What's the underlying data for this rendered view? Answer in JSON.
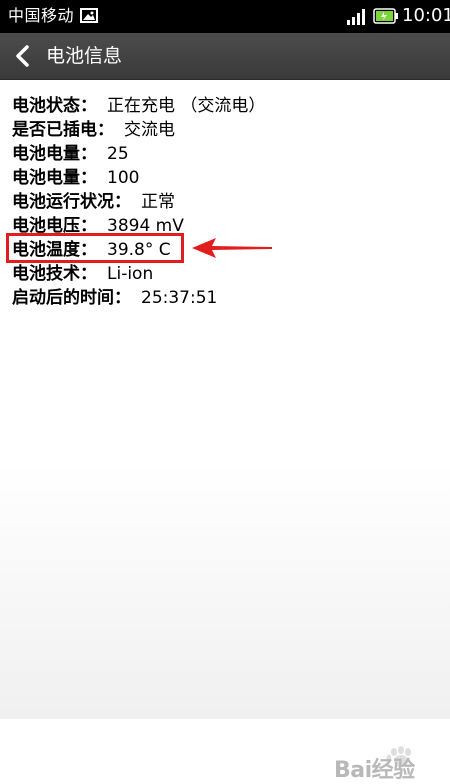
{
  "status_bar": {
    "carrier": "中国移动",
    "time": "10:01",
    "icons": [
      "picture-icon",
      "signal-icon",
      "battery-icon"
    ]
  },
  "header": {
    "title": "电池信息",
    "back_icon": "chevron-left-icon"
  },
  "battery_info": [
    {
      "label": "电池状态：",
      "value": "正在充电 （交流电）"
    },
    {
      "label": "是否已插电：",
      "value": "交流电"
    },
    {
      "label": "电池电量：",
      "value": "25"
    },
    {
      "label": "电池电量：",
      "value": "100"
    },
    {
      "label": "电池运行状况：",
      "value": "正常"
    },
    {
      "label": "电池电压：",
      "value": "3894 mV"
    },
    {
      "label": "电池温度：",
      "value": "39.8° C"
    },
    {
      "label": "电池技术：",
      "value": "Li-ion"
    },
    {
      "label": "启动后的时间：",
      "value": "25:37:51"
    }
  ],
  "annotation": {
    "highlighted_row": "电池温度",
    "color": "#e01e1e"
  },
  "watermark": {
    "text": "Bai经验"
  },
  "colors": {
    "status_bar_bg": "#000000",
    "title_bar_bg": "#444444",
    "battery_fill": "#7bd43a",
    "annotation_red": "#e01e1e"
  }
}
